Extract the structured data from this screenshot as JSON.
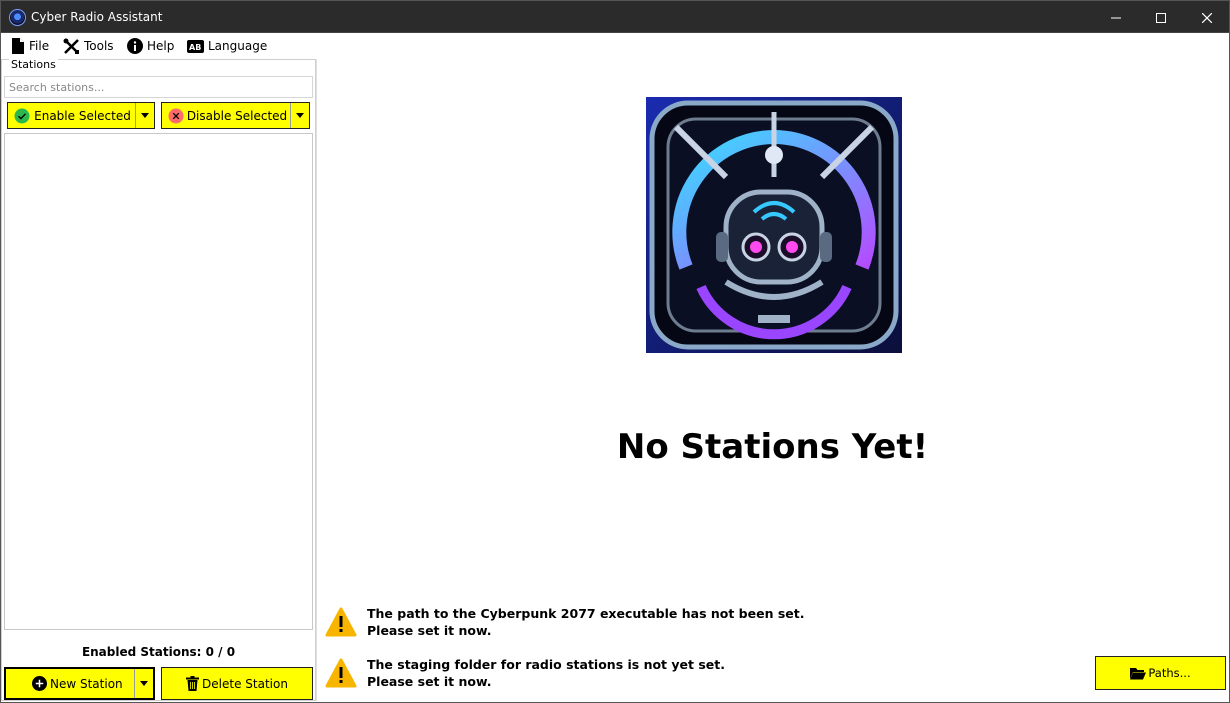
{
  "window": {
    "title": "Cyber Radio Assistant",
    "minimize": "minimize",
    "maximize": "maximize",
    "close": "close"
  },
  "menu": [
    {
      "label": "File",
      "icon": "file-icon"
    },
    {
      "label": "Tools",
      "icon": "tools-icon"
    },
    {
      "label": "Help",
      "icon": "info-icon"
    },
    {
      "label": "Language",
      "icon": "language-icon"
    }
  ],
  "stations": {
    "group_label": "Stations",
    "search_placeholder": "Search stations...",
    "enable_label": "Enable Selected",
    "disable_label": "Disable Selected",
    "enabled_text": "Enabled Stations: 0 / 0",
    "new_label": "New Station",
    "delete_label": "Delete Station"
  },
  "main": {
    "empty_title": "No Stations Yet!",
    "warnings": [
      {
        "line1": "The path to the Cyberpunk 2077 executable has not been set.",
        "line2": "Please set it now."
      },
      {
        "line1": "The staging folder for radio stations is not yet set.",
        "line2": "Please set it now."
      }
    ],
    "paths_label": "Paths..."
  },
  "colors": {
    "button_yellow": "#ffff00",
    "titlebar": "#2b2b2b",
    "enable_green": "#2db84d",
    "disable_red": "#ff6b6b",
    "warning_amber": "#f7b500"
  }
}
